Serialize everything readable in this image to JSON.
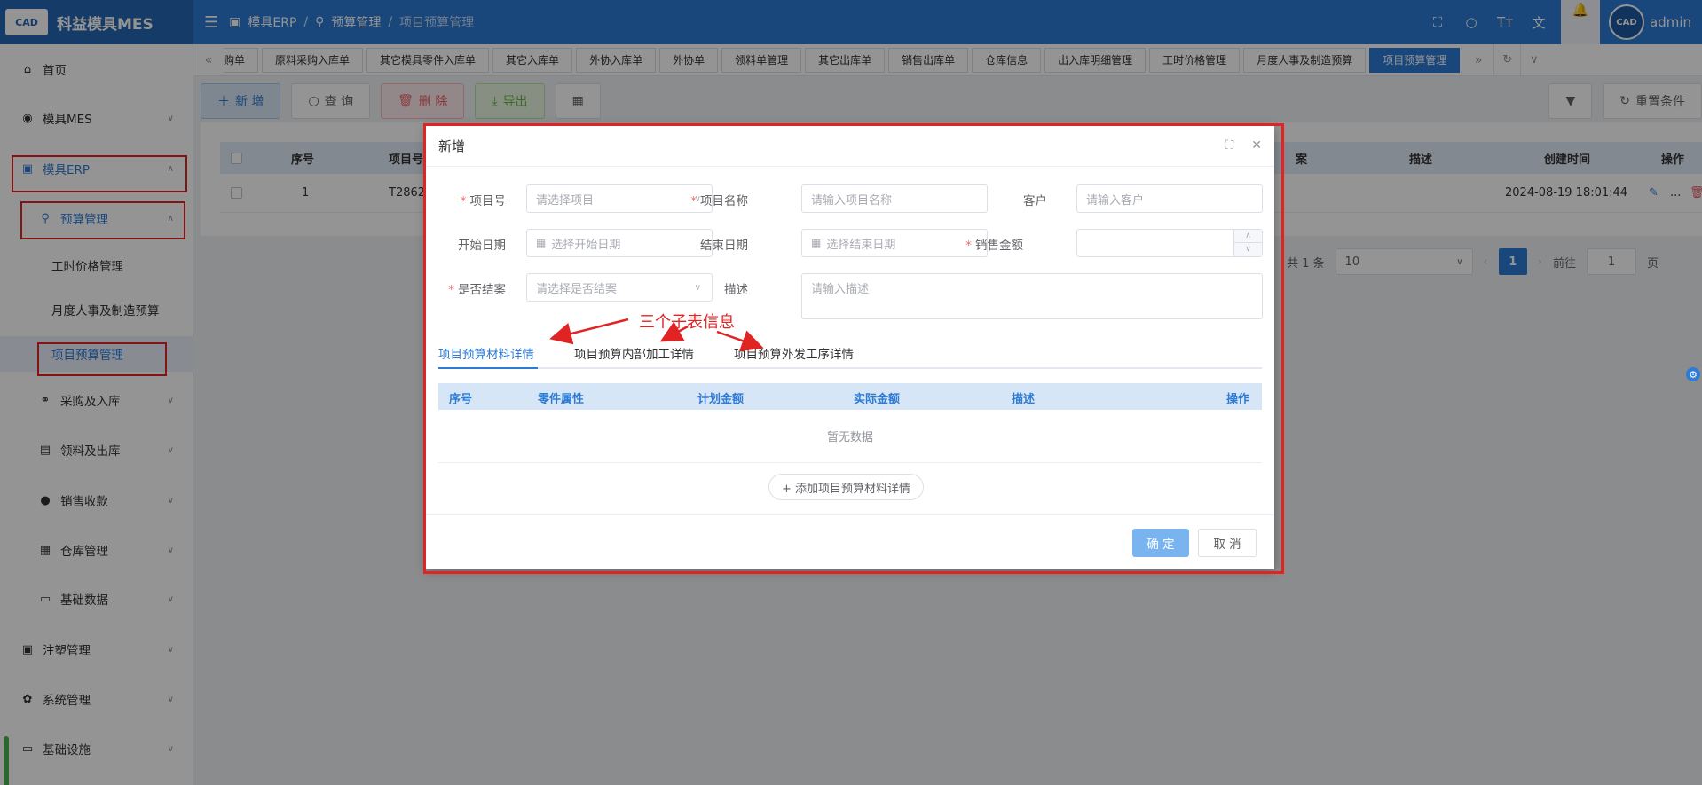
{
  "brand": {
    "logo_text": "CAD",
    "name": "科益模具MES"
  },
  "breadcrumb": {
    "root": "模具ERP",
    "level2": "预算管理",
    "current": "项目预算管理"
  },
  "user": {
    "name": "admin",
    "avatar_text": "CAD"
  },
  "sidebar": {
    "home": "首页",
    "mes": "模具MES",
    "erp": "模具ERP",
    "budget": "预算管理",
    "labor_price": "工时价格管理",
    "monthly_budget": "月度人事及制造预算",
    "project_budget": "项目预算管理",
    "purchase": "采购及入库",
    "material_out": "领料及出库",
    "sales": "销售收款",
    "warehouse": "仓库管理",
    "basic_data": "基础数据",
    "injection": "注塑管理",
    "system": "系统管理",
    "infra": "基础设施"
  },
  "tabs": [
    "购单",
    "原料采购入库单",
    "其它模具零件入库单",
    "其它入库单",
    "外协入库单",
    "外协单",
    "领料单管理",
    "其它出库单",
    "销售出库单",
    "仓库信息",
    "出入库明细管理",
    "工时价格管理",
    "月度人事及制造预算",
    "项目预算管理"
  ],
  "toolbar": {
    "add": "新 增",
    "query": "查 询",
    "delete": "删 除",
    "export": "导出",
    "reset": "重置条件"
  },
  "table": {
    "headers": {
      "seq": "序号",
      "project_no": "项目号",
      "col_partial": "案",
      "desc": "描述",
      "created": "创建时间",
      "ops": "操作"
    },
    "rows": [
      {
        "seq": "1",
        "project_no": "T2862",
        "created": "2024-08-19 18:01:44",
        "ops_more": "..."
      }
    ]
  },
  "pager": {
    "total": "共 1 条",
    "size": "10",
    "page": "1",
    "goto_label": "前往",
    "goto_value": "1",
    "page_unit": "页"
  },
  "dialog": {
    "title": "新增",
    "fields": {
      "project_no_label": "项目号",
      "project_no_ph": "请选择项目",
      "project_name_label": "项目名称",
      "project_name_ph": "请输入项目名称",
      "customer_label": "客户",
      "customer_ph": "请输入客户",
      "start_label": "开始日期",
      "start_ph": "选择开始日期",
      "end_label": "结束日期",
      "end_ph": "选择结束日期",
      "amount_label": "销售金额",
      "closed_label": "是否结案",
      "closed_ph": "请选择是否结案",
      "desc_label": "描述",
      "desc_ph": "请输入描述"
    },
    "subtabs": [
      "项目预算材料详情",
      "项目预算内部加工详情",
      "项目预算外发工序详情"
    ],
    "sub_headers": [
      "序号",
      "零件属性",
      "计划金额",
      "实际金额",
      "描述",
      "操作"
    ],
    "empty_text": "暂无数据",
    "add_detail": "+ 添加项目预算材料详情",
    "ok": "确 定",
    "cancel": "取 消"
  },
  "annotation": "三个子表信息",
  "colors": {
    "primary": "#2d7bd5",
    "highlight_red": "#e02424"
  }
}
